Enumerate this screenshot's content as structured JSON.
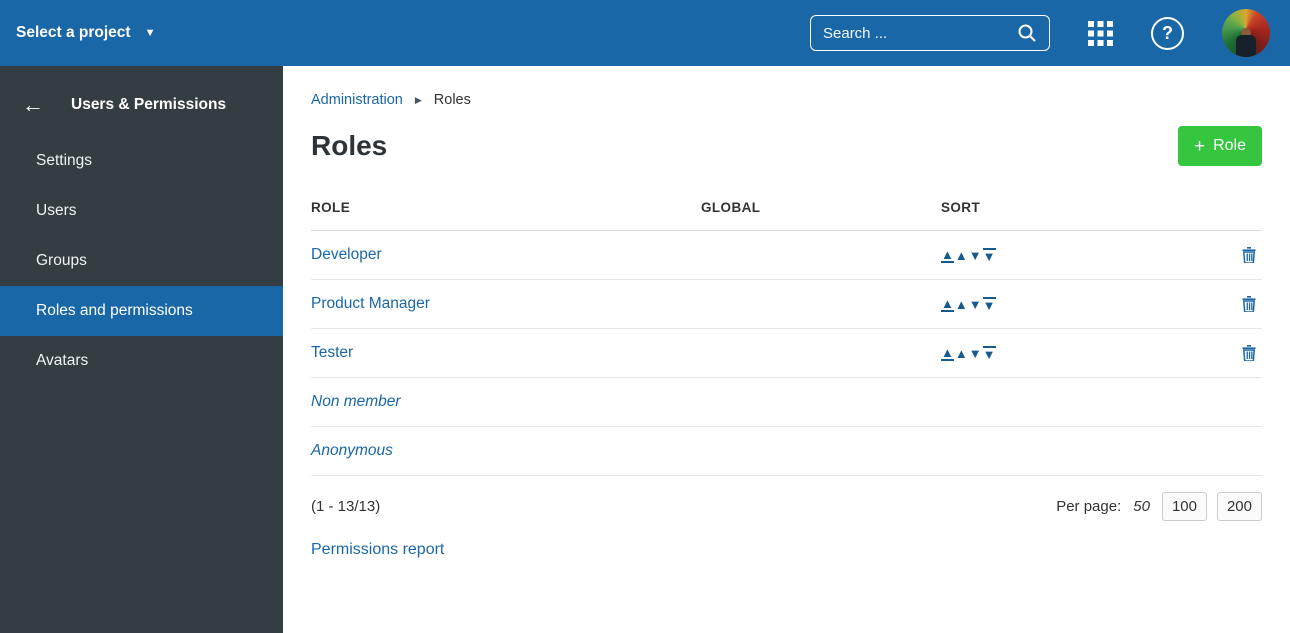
{
  "topbar": {
    "project_selector_label": "Select a project",
    "search_placeholder": "Search ...",
    "icons": [
      "search-icon",
      "modules-grid-icon",
      "help-icon",
      "user-avatar"
    ],
    "bg_color": "#1A67A7"
  },
  "sidebar": {
    "title": "Users & Permissions",
    "back_icon": "←",
    "items": [
      {
        "label": "Settings",
        "active": false
      },
      {
        "label": "Users",
        "active": false
      },
      {
        "label": "Groups",
        "active": false
      },
      {
        "label": "Roles and permissions",
        "active": true
      },
      {
        "label": "Avatars",
        "active": false
      }
    ],
    "bg_color": "#333d42",
    "active_bg_color": "#1A67A7"
  },
  "breadcrumb": {
    "items": [
      "Administration",
      "Roles"
    ]
  },
  "page": {
    "title": "Roles",
    "add_button_label": "Role",
    "add_button_color": "#35c53f"
  },
  "table": {
    "headers": [
      "ROLE",
      "GLOBAL",
      "SORT"
    ],
    "rows": [
      {
        "name": "Developer",
        "builtin": false,
        "has_sort": true,
        "has_delete": true
      },
      {
        "name": "Product Manager",
        "builtin": false,
        "has_sort": true,
        "has_delete": true
      },
      {
        "name": "Tester",
        "builtin": false,
        "has_sort": true,
        "has_delete": true
      },
      {
        "name": "Non member",
        "builtin": true,
        "has_sort": false,
        "has_delete": false
      },
      {
        "name": "Anonymous",
        "builtin": true,
        "has_sort": false,
        "has_delete": false
      }
    ],
    "sort_icons": [
      "move-to-top",
      "move-up",
      "move-down",
      "move-to-bottom"
    ],
    "link_color": "#1A67A7"
  },
  "pagination": {
    "range_text": "(1 - 13/13)",
    "per_page_label": "Per page:",
    "current": "50",
    "options": [
      "100",
      "200"
    ]
  },
  "footer_link": "Permissions report"
}
